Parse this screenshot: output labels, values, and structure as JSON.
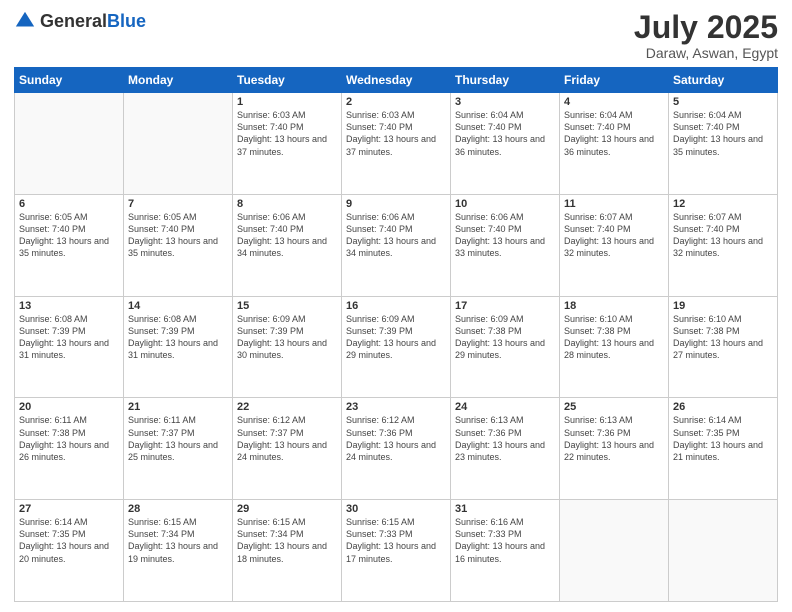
{
  "header": {
    "logo_general": "General",
    "logo_blue": "Blue",
    "month_title": "July 2025",
    "location": "Daraw, Aswan, Egypt"
  },
  "weekdays": [
    "Sunday",
    "Monday",
    "Tuesday",
    "Wednesday",
    "Thursday",
    "Friday",
    "Saturday"
  ],
  "weeks": [
    [
      {
        "day": "",
        "info": ""
      },
      {
        "day": "",
        "info": ""
      },
      {
        "day": "1",
        "info": "Sunrise: 6:03 AM\nSunset: 7:40 PM\nDaylight: 13 hours and 37 minutes."
      },
      {
        "day": "2",
        "info": "Sunrise: 6:03 AM\nSunset: 7:40 PM\nDaylight: 13 hours and 37 minutes."
      },
      {
        "day": "3",
        "info": "Sunrise: 6:04 AM\nSunset: 7:40 PM\nDaylight: 13 hours and 36 minutes."
      },
      {
        "day": "4",
        "info": "Sunrise: 6:04 AM\nSunset: 7:40 PM\nDaylight: 13 hours and 36 minutes."
      },
      {
        "day": "5",
        "info": "Sunrise: 6:04 AM\nSunset: 7:40 PM\nDaylight: 13 hours and 35 minutes."
      }
    ],
    [
      {
        "day": "6",
        "info": "Sunrise: 6:05 AM\nSunset: 7:40 PM\nDaylight: 13 hours and 35 minutes."
      },
      {
        "day": "7",
        "info": "Sunrise: 6:05 AM\nSunset: 7:40 PM\nDaylight: 13 hours and 35 minutes."
      },
      {
        "day": "8",
        "info": "Sunrise: 6:06 AM\nSunset: 7:40 PM\nDaylight: 13 hours and 34 minutes."
      },
      {
        "day": "9",
        "info": "Sunrise: 6:06 AM\nSunset: 7:40 PM\nDaylight: 13 hours and 34 minutes."
      },
      {
        "day": "10",
        "info": "Sunrise: 6:06 AM\nSunset: 7:40 PM\nDaylight: 13 hours and 33 minutes."
      },
      {
        "day": "11",
        "info": "Sunrise: 6:07 AM\nSunset: 7:40 PM\nDaylight: 13 hours and 32 minutes."
      },
      {
        "day": "12",
        "info": "Sunrise: 6:07 AM\nSunset: 7:40 PM\nDaylight: 13 hours and 32 minutes."
      }
    ],
    [
      {
        "day": "13",
        "info": "Sunrise: 6:08 AM\nSunset: 7:39 PM\nDaylight: 13 hours and 31 minutes."
      },
      {
        "day": "14",
        "info": "Sunrise: 6:08 AM\nSunset: 7:39 PM\nDaylight: 13 hours and 31 minutes."
      },
      {
        "day": "15",
        "info": "Sunrise: 6:09 AM\nSunset: 7:39 PM\nDaylight: 13 hours and 30 minutes."
      },
      {
        "day": "16",
        "info": "Sunrise: 6:09 AM\nSunset: 7:39 PM\nDaylight: 13 hours and 29 minutes."
      },
      {
        "day": "17",
        "info": "Sunrise: 6:09 AM\nSunset: 7:38 PM\nDaylight: 13 hours and 29 minutes."
      },
      {
        "day": "18",
        "info": "Sunrise: 6:10 AM\nSunset: 7:38 PM\nDaylight: 13 hours and 28 minutes."
      },
      {
        "day": "19",
        "info": "Sunrise: 6:10 AM\nSunset: 7:38 PM\nDaylight: 13 hours and 27 minutes."
      }
    ],
    [
      {
        "day": "20",
        "info": "Sunrise: 6:11 AM\nSunset: 7:38 PM\nDaylight: 13 hours and 26 minutes."
      },
      {
        "day": "21",
        "info": "Sunrise: 6:11 AM\nSunset: 7:37 PM\nDaylight: 13 hours and 25 minutes."
      },
      {
        "day": "22",
        "info": "Sunrise: 6:12 AM\nSunset: 7:37 PM\nDaylight: 13 hours and 24 minutes."
      },
      {
        "day": "23",
        "info": "Sunrise: 6:12 AM\nSunset: 7:36 PM\nDaylight: 13 hours and 24 minutes."
      },
      {
        "day": "24",
        "info": "Sunrise: 6:13 AM\nSunset: 7:36 PM\nDaylight: 13 hours and 23 minutes."
      },
      {
        "day": "25",
        "info": "Sunrise: 6:13 AM\nSunset: 7:36 PM\nDaylight: 13 hours and 22 minutes."
      },
      {
        "day": "26",
        "info": "Sunrise: 6:14 AM\nSunset: 7:35 PM\nDaylight: 13 hours and 21 minutes."
      }
    ],
    [
      {
        "day": "27",
        "info": "Sunrise: 6:14 AM\nSunset: 7:35 PM\nDaylight: 13 hours and 20 minutes."
      },
      {
        "day": "28",
        "info": "Sunrise: 6:15 AM\nSunset: 7:34 PM\nDaylight: 13 hours and 19 minutes."
      },
      {
        "day": "29",
        "info": "Sunrise: 6:15 AM\nSunset: 7:34 PM\nDaylight: 13 hours and 18 minutes."
      },
      {
        "day": "30",
        "info": "Sunrise: 6:15 AM\nSunset: 7:33 PM\nDaylight: 13 hours and 17 minutes."
      },
      {
        "day": "31",
        "info": "Sunrise: 6:16 AM\nSunset: 7:33 PM\nDaylight: 13 hours and 16 minutes."
      },
      {
        "day": "",
        "info": ""
      },
      {
        "day": "",
        "info": ""
      }
    ]
  ]
}
